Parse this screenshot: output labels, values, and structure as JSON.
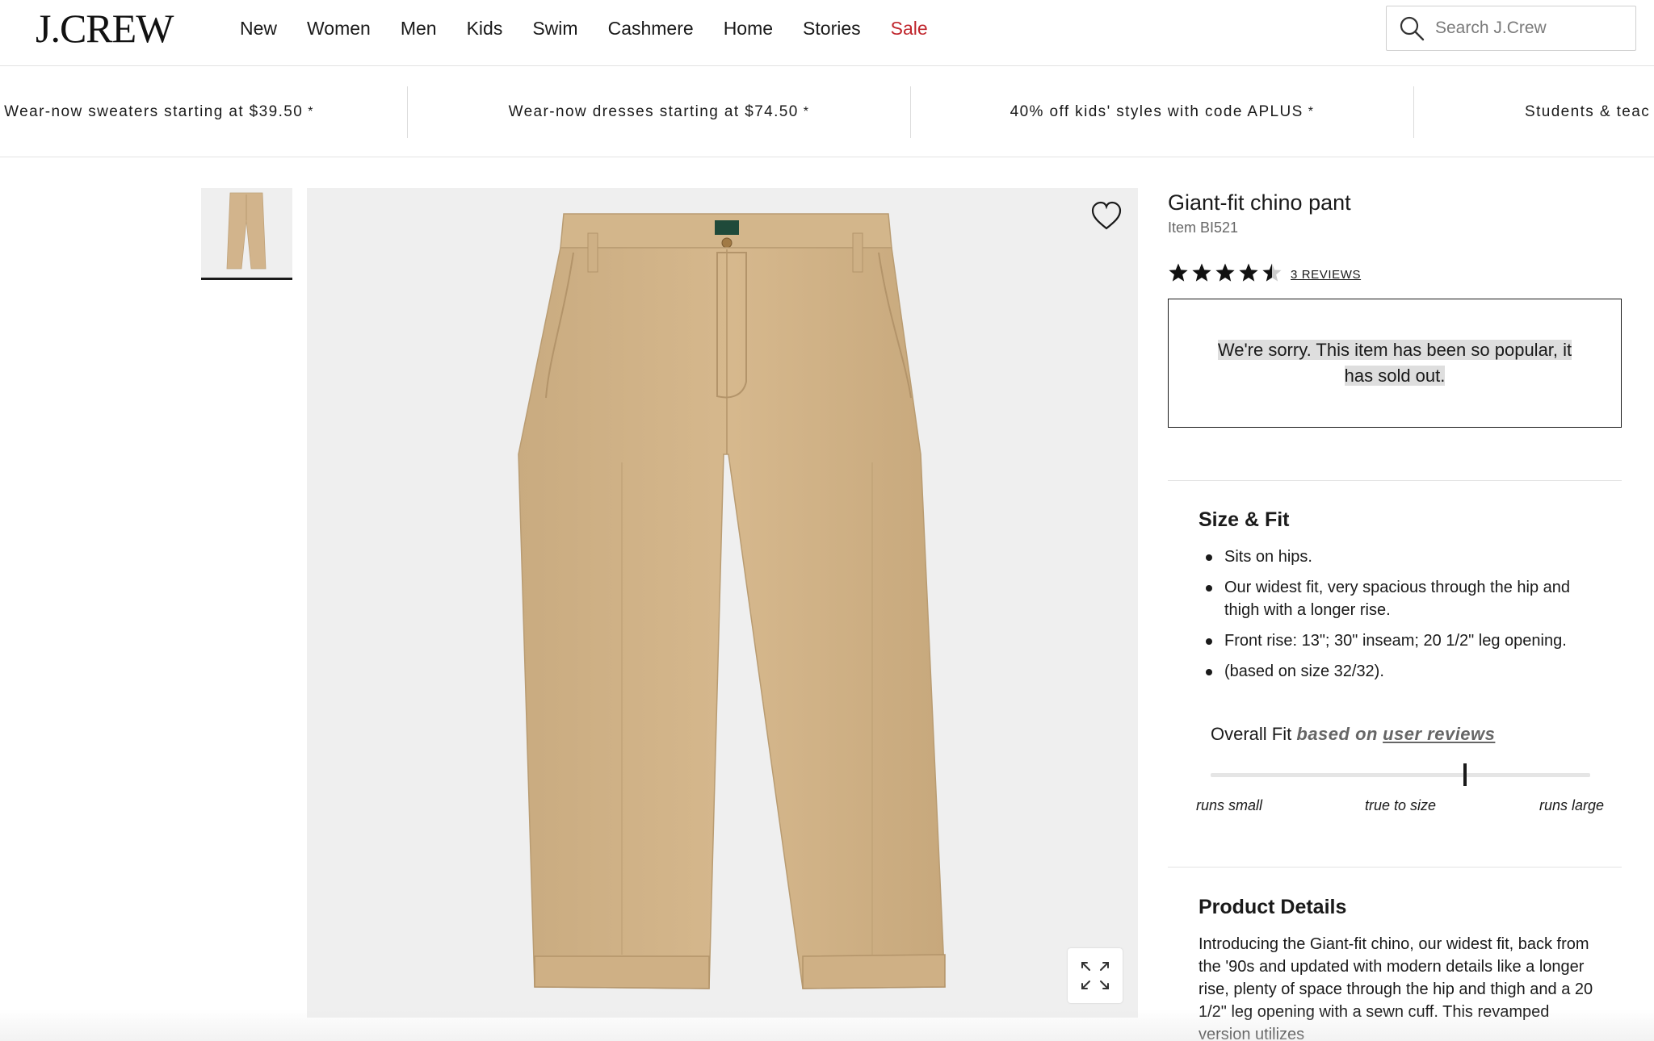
{
  "header": {
    "logo": "J.CREW",
    "nav": [
      "New",
      "Women",
      "Men",
      "Kids",
      "Swim",
      "Cashmere",
      "Home",
      "Stories",
      "Sale"
    ],
    "search_placeholder": "Search J.Crew"
  },
  "promos": [
    "Wear-now sweaters starting at $39.50",
    "Wear-now dresses starting at $74.50",
    "40% off kids' styles with code APLUS",
    "Students & teac"
  ],
  "promo_star": "*",
  "product": {
    "title": "Giant-fit chino pant",
    "item": "Item BI521",
    "rating": 4.5,
    "rating_max": 5,
    "reviews_label": "3 REVIEWS",
    "soldout_message": "We're sorry. This item has been so popular, it has sold out."
  },
  "size_fit": {
    "title": "Size & Fit",
    "bullets": [
      "Sits on hips.",
      "Our widest fit, very spacious through the hip and thigh with a longer rise.",
      "Front rise: 13\"; 30\" inseam; 20 1/2\" leg opening.",
      "(based on size 32/32)."
    ],
    "overall_fit_label": "Overall Fit",
    "based_on": "based on",
    "user_reviews": "user reviews",
    "fit_value": 0.67,
    "scale_labels": [
      "runs small",
      "true to size",
      "runs large"
    ]
  },
  "product_details": {
    "title": "Product Details",
    "text": "Introducing the Giant-fit chino, our widest fit, back from the '90s and updated with modern details like a longer rise, plenty of space through the hip and thigh and a 20 1/2\" leg opening with a sewn cuff. This revamped version utilizes"
  },
  "colors": {
    "sale": "#c0262d",
    "khaki": "#d2b48c",
    "image_bg": "#efefef"
  },
  "icons": {
    "search": "search-icon",
    "wishlist": "heart-icon",
    "expand": "expand-icon",
    "star": "star-icon"
  }
}
